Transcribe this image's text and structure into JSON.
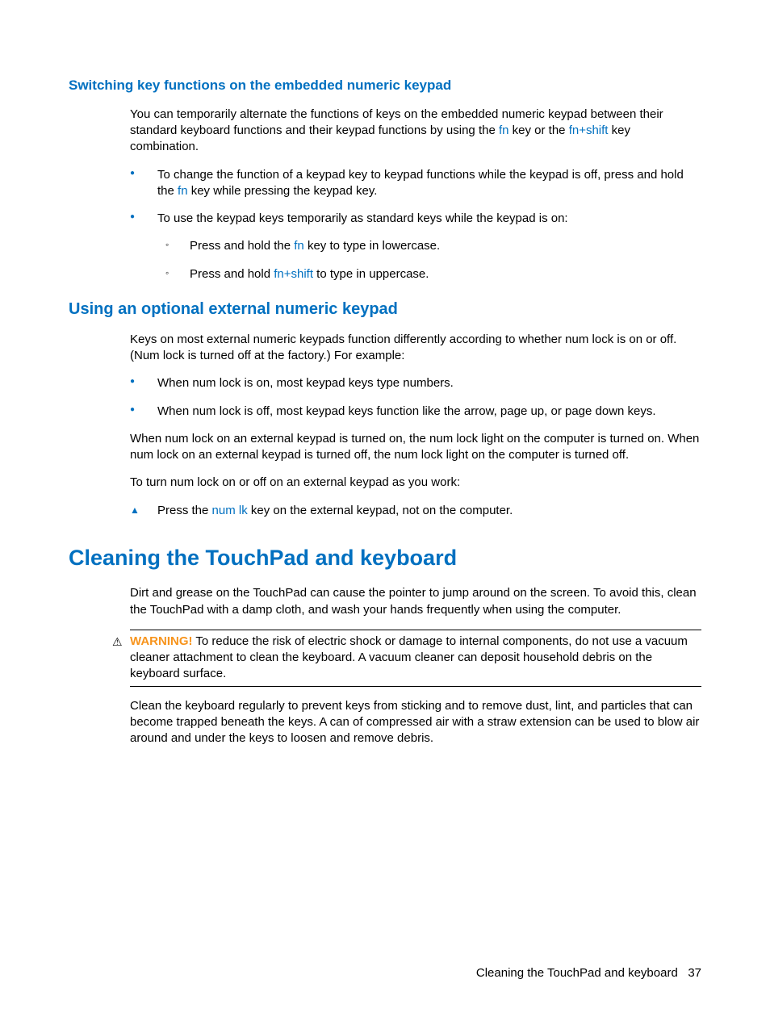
{
  "s1": {
    "heading": "Switching key functions on the embedded numeric keypad",
    "intro_a": "You can temporarily alternate the functions of keys on the embedded numeric keypad between their standard keyboard functions and their keypad functions by using the ",
    "fn": "fn",
    "intro_b": " key or the ",
    "fnshift": "fn+shift",
    "intro_c": " key combination.",
    "b1a": "To change the function of a keypad key to keypad functions while the keypad is off, press and hold the ",
    "b1b": " key while pressing the keypad key.",
    "b2": "To use the keypad keys temporarily as standard keys while the keypad is on:",
    "b2s1a": "Press and hold the ",
    "b2s1b": " key to type in lowercase.",
    "b2s2a": "Press and hold ",
    "b2s2b": " to type in uppercase."
  },
  "s2": {
    "heading": "Using an optional external numeric keypad",
    "intro": "Keys on most external numeric keypads function differently according to whether num lock is on or off. (Num lock is turned off at the factory.) For example:",
    "b1": "When num lock is on, most keypad keys type numbers.",
    "b2": "When num lock is off, most keypad keys function like the arrow, page up, or page down keys.",
    "p2": "When num lock on an external keypad is turned on, the num lock light on the computer is turned on. When num lock on an external keypad is turned off, the num lock light on the computer is turned off.",
    "p3": "To turn num lock on or off on an external keypad as you work:",
    "tri_a": "Press the ",
    "numlk": "num lk",
    "tri_b": " key on the external keypad, not on the computer."
  },
  "s3": {
    "heading": "Cleaning the TouchPad and keyboard",
    "p1": "Dirt and grease on the TouchPad can cause the pointer to jump around on the screen. To avoid this, clean the TouchPad with a damp cloth, and wash your hands frequently when using the computer.",
    "warn_label": "WARNING!",
    "warn_body": "   To reduce the risk of electric shock or damage to internal components, do not use a vacuum cleaner attachment to clean the keyboard. A vacuum cleaner can deposit household debris on the keyboard surface.",
    "p2": "Clean the keyboard regularly to prevent keys from sticking and to remove dust, lint, and particles that can become trapped beneath the keys. A can of compressed air with a straw extension can be used to blow air around and under the keys to loosen and remove debris."
  },
  "footer": {
    "title": "Cleaning the TouchPad and keyboard",
    "page": "37"
  }
}
